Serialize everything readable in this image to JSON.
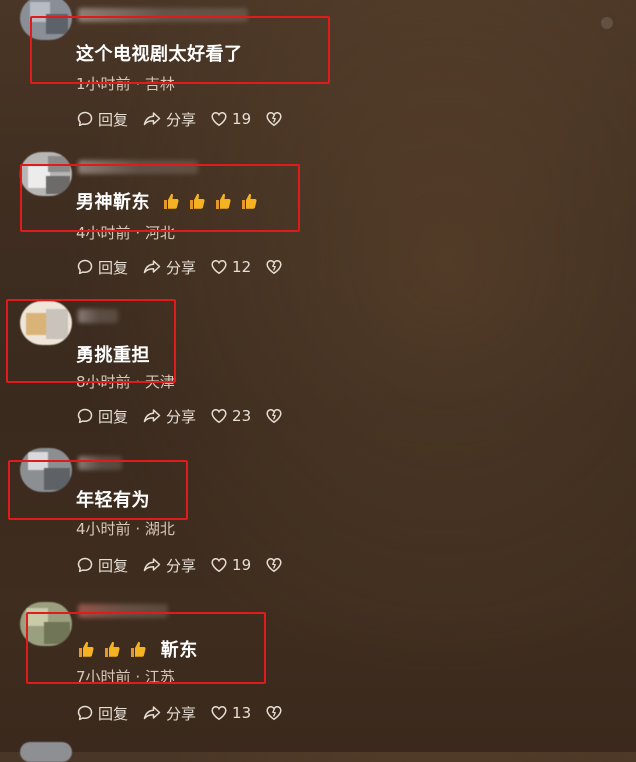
{
  "comments": [
    {
      "text": "这个电视剧太好看了",
      "text_prefix_thumbs": 0,
      "text_suffix_thumbs": 0,
      "time": "1小时前",
      "location": "吉林",
      "reply_label": "回复",
      "share_label": "分享",
      "likes": "19"
    },
    {
      "text": "男神靳东",
      "text_prefix_thumbs": 0,
      "text_suffix_thumbs": 4,
      "time": "4小时前",
      "location": "河北",
      "reply_label": "回复",
      "share_label": "分享",
      "likes": "12"
    },
    {
      "text": "勇挑重担",
      "text_prefix_thumbs": 0,
      "text_suffix_thumbs": 0,
      "time": "8小时前",
      "location": "天津",
      "reply_label": "回复",
      "share_label": "分享",
      "likes": "23"
    },
    {
      "text": "年轻有为",
      "text_prefix_thumbs": 0,
      "text_suffix_thumbs": 0,
      "time": "4小时前",
      "location": "湖北",
      "reply_label": "回复",
      "share_label": "分享",
      "likes": "19"
    },
    {
      "text": "靳东",
      "text_prefix_thumbs": 3,
      "text_suffix_thumbs": 0,
      "time": "7小时前",
      "location": "江苏",
      "reply_label": "回复",
      "share_label": "分享",
      "likes": "13"
    }
  ],
  "separator": " · ",
  "colors": {
    "highlight_box": "#e01b1b",
    "thumb_emoji": "#f5b321",
    "text": "#ffffff",
    "meta": "#d7c8b8"
  },
  "icons": [
    "comment-icon",
    "share-icon",
    "heart-icon",
    "dislike-heart-icon",
    "thumbs-up-icon"
  ]
}
